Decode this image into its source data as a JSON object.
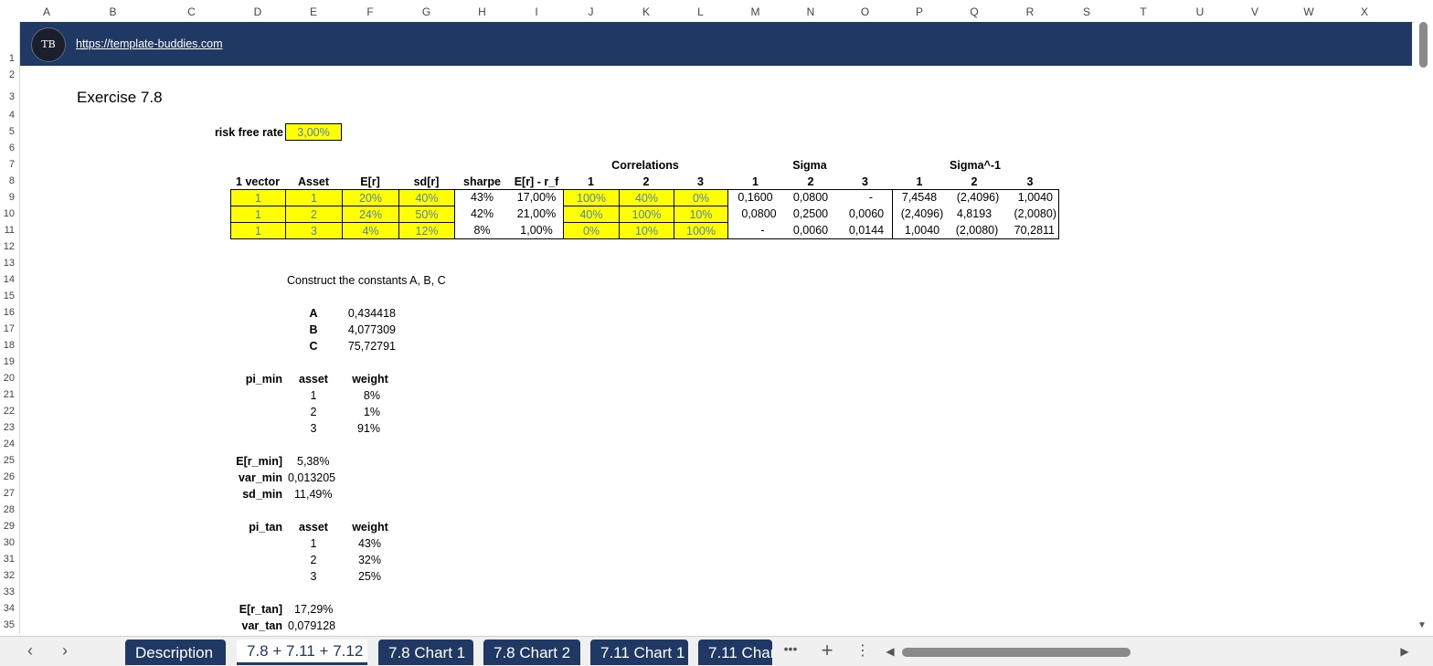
{
  "columns": [
    "A",
    "B",
    "C",
    "D",
    "E",
    "F",
    "G",
    "H",
    "I",
    "J",
    "K",
    "L",
    "M",
    "N",
    "O",
    "P",
    "Q",
    "R",
    "S",
    "T",
    "U",
    "V",
    "W",
    "X"
  ],
  "rows": [
    "1",
    "2",
    "3",
    "4",
    "5",
    "6",
    "7",
    "8",
    "9",
    "10",
    "11",
    "12",
    "13",
    "14",
    "15",
    "16",
    "17",
    "18",
    "19",
    "20",
    "21",
    "22",
    "23",
    "24",
    "25",
    "26",
    "27",
    "28",
    "29",
    "30",
    "31",
    "32",
    "33",
    "34",
    "35"
  ],
  "banner": {
    "logo_text": "TB",
    "link": "https://template-buddies.com"
  },
  "title": "Exercise 7.8",
  "rf": {
    "label": "risk free rate",
    "value": "3,00%"
  },
  "group_headers": {
    "correlations": "Correlations",
    "sigma": "Sigma",
    "sigma_inv": "Sigma^-1"
  },
  "headers": [
    "1 vector",
    "Asset",
    "E[r]",
    "sd[r]",
    "sharpe",
    "E[r] - r_f",
    "1",
    "2",
    "3",
    "1",
    "2",
    "3",
    "1",
    "2",
    "3"
  ],
  "table": [
    [
      "1",
      "1",
      "20%",
      "40%",
      "43%",
      "17,00%",
      "100%",
      "40%",
      "0%",
      "0,1600",
      "0,0800",
      "-",
      "7,4548",
      "(2,4096)",
      "1,0040"
    ],
    [
      "1",
      "2",
      "24%",
      "50%",
      "42%",
      "21,00%",
      "40%",
      "100%",
      "10%",
      "0,0800",
      "0,2500",
      "0,0060",
      "(2,4096)",
      "4,8193",
      "(2,0080)"
    ],
    [
      "1",
      "3",
      "4%",
      "12%",
      "8%",
      "1,00%",
      "0%",
      "10%",
      "100%",
      "-",
      "0,0060",
      "0,0144",
      "1,0040",
      "(2,0080)",
      "70,2811"
    ]
  ],
  "constants": {
    "label": "Construct the constants A, B, C",
    "items": [
      {
        "name": "A",
        "value": "0,434418"
      },
      {
        "name": "B",
        "value": "4,077309"
      },
      {
        "name": "C",
        "value": "75,72791"
      }
    ]
  },
  "pi_min": {
    "label": "pi_min",
    "col_asset": "asset",
    "col_weight": "weight",
    "rows": [
      {
        "asset": "1",
        "weight": "8%"
      },
      {
        "asset": "2",
        "weight": "1%"
      },
      {
        "asset": "3",
        "weight": "91%"
      }
    ]
  },
  "min_stats": [
    {
      "label": "E[r_min]",
      "value": "5,38%"
    },
    {
      "label": "var_min",
      "value": "0,013205"
    },
    {
      "label": "sd_min",
      "value": "11,49%"
    }
  ],
  "pi_tan": {
    "label": "pi_tan",
    "col_asset": "asset",
    "col_weight": "weight",
    "rows": [
      {
        "asset": "1",
        "weight": "43%"
      },
      {
        "asset": "2",
        "weight": "32%"
      },
      {
        "asset": "3",
        "weight": "25%"
      }
    ]
  },
  "tan_stats": [
    {
      "label": "E[r_tan]",
      "value": "17,29%"
    },
    {
      "label": "var_tan",
      "value": "0,079128"
    }
  ],
  "tabs": [
    "Description",
    "7.8 + 7.11 + 7.12",
    "7.8 Chart 1",
    "7.8 Chart 2",
    "7.11 Chart 1",
    "7.11 Char"
  ],
  "active_tab": "7.8 + 7.11 + 7.12",
  "colors": {
    "banner": "#203864",
    "input_fill": "#ffff00",
    "input_text": "#4f81bd"
  },
  "icons": {
    "prev": "chevron-left-icon",
    "next": "chevron-right-icon",
    "more": "more-icon",
    "add": "plus-icon",
    "options": "kebab-icon"
  }
}
